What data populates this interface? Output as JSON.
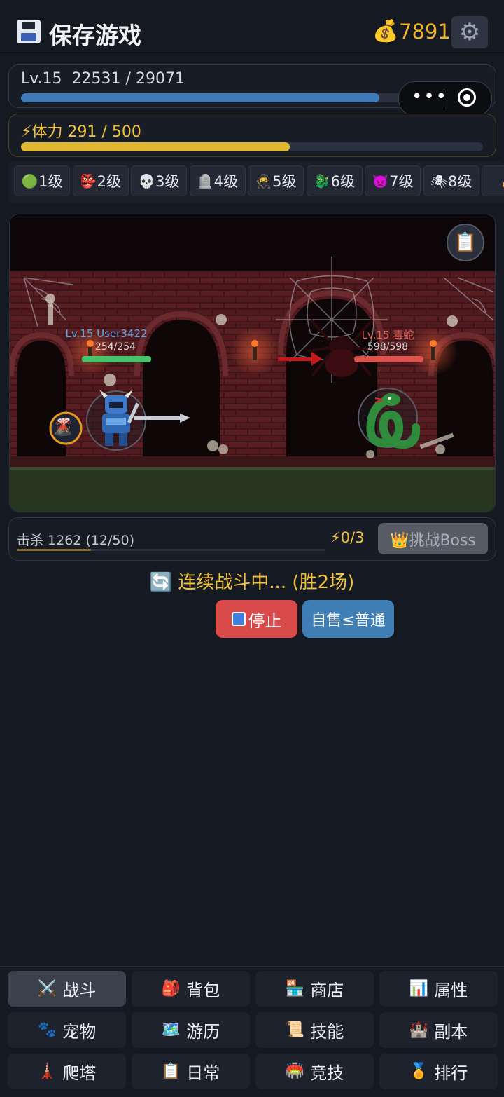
{
  "header": {
    "title": "保存游戏",
    "coin_icon": "💰",
    "coins": "7891",
    "settings_icon": "⚙"
  },
  "level": {
    "label": "Lv.15",
    "exp": "22531 / 29071",
    "exp_current": 22531,
    "exp_max": 29071
  },
  "mini_program_capsule": {
    "more": "•••"
  },
  "stamina": {
    "label": "⚡体力 291 / 500",
    "current": 291,
    "max": 500,
    "color": "#e0b733"
  },
  "level_tabs": [
    {
      "icon": "🟢",
      "label": "1级"
    },
    {
      "icon": "👺",
      "label": "2级"
    },
    {
      "icon": "💀",
      "label": "3级"
    },
    {
      "icon": "🪦",
      "label": "4级"
    },
    {
      "icon": "🥷",
      "label": "5级"
    },
    {
      "icon": "🐉",
      "label": "6级"
    },
    {
      "icon": "👿",
      "label": "7级"
    },
    {
      "icon": "🕷",
      "label": "8级"
    },
    {
      "icon": "🦂",
      "label": ""
    }
  ],
  "battle": {
    "log_icon": "📋",
    "player": {
      "name": "Lv.15 User3422",
      "hp": "254/254"
    },
    "enemy": {
      "name": "Lv.15 毒蛇",
      "hp": "598/598"
    },
    "skill_icon": "🌋"
  },
  "kills": {
    "text": "击杀 1262 (12/50)",
    "progress": 0.24,
    "energy": "⚡0/3",
    "boss_button": "👑挑战Boss"
  },
  "status": "🔄 连续战斗中... (胜2场)",
  "actions": {
    "stop": "停止",
    "autosell": "自售≤普通"
  },
  "nav": [
    {
      "icon": "⚔️",
      "label": "战斗",
      "active": true
    },
    {
      "icon": "🎒",
      "label": "背包"
    },
    {
      "icon": "🏪",
      "label": "商店"
    },
    {
      "icon": "📊",
      "label": "属性"
    },
    {
      "icon": "🐾",
      "label": "宠物"
    },
    {
      "icon": "🗺️",
      "label": "游历"
    },
    {
      "icon": "📜",
      "label": "技能"
    },
    {
      "icon": "🏰",
      "label": "副本"
    },
    {
      "icon": "🗼",
      "label": "爬塔"
    },
    {
      "icon": "📋",
      "label": "日常"
    },
    {
      "icon": "🏟️",
      "label": "竞技"
    },
    {
      "icon": "🏅",
      "label": "排行"
    }
  ]
}
